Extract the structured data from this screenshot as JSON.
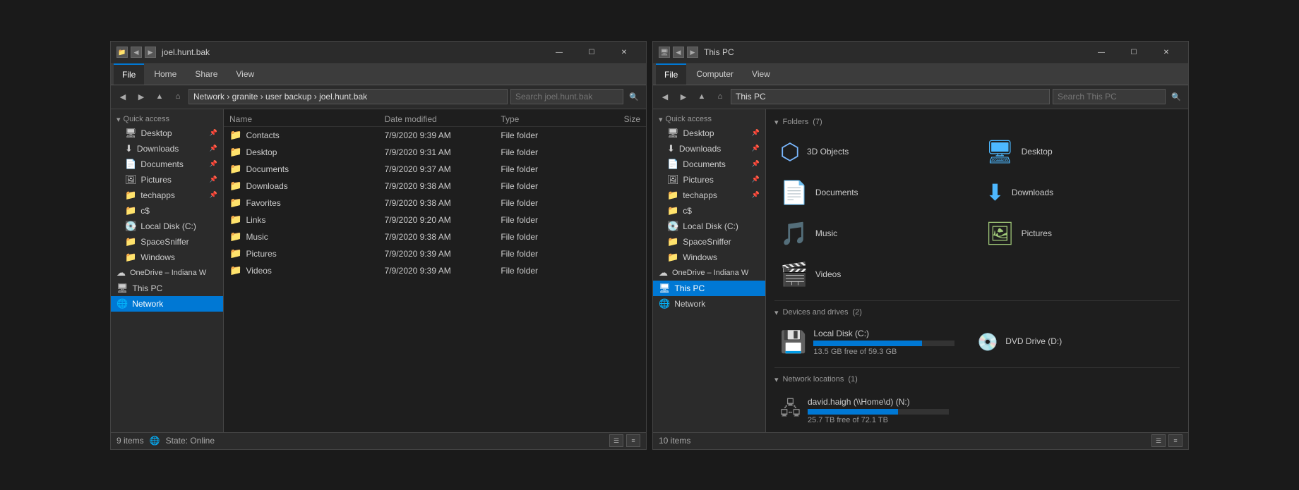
{
  "left_window": {
    "title": "joel.hunt.bak",
    "title_bar": {
      "icons": [
        "folder-icon",
        "back-icon",
        "forward-icon"
      ],
      "minimize": "—",
      "maximize": "☐",
      "close": "✕"
    },
    "ribbon_tabs": [
      "File",
      "Home",
      "Share",
      "View"
    ],
    "active_tab": "Home",
    "address_path": "Network > granite > user backup > joel.hunt.bak",
    "search_placeholder": "Search joel.hunt.bak",
    "nav": {
      "back_disabled": false,
      "forward_disabled": false
    },
    "columns": {
      "name": "Name",
      "date_modified": "Date modified",
      "type": "Type",
      "size": "Size"
    },
    "files": [
      {
        "name": "Contacts",
        "date": "7/9/2020 9:39 AM",
        "type": "File folder",
        "size": ""
      },
      {
        "name": "Desktop",
        "date": "7/9/2020 9:31 AM",
        "type": "File folder",
        "size": ""
      },
      {
        "name": "Documents",
        "date": "7/9/2020 9:37 AM",
        "type": "File folder",
        "size": ""
      },
      {
        "name": "Downloads",
        "date": "7/9/2020 9:38 AM",
        "type": "File folder",
        "size": ""
      },
      {
        "name": "Favorites",
        "date": "7/9/2020 9:38 AM",
        "type": "File folder",
        "size": ""
      },
      {
        "name": "Links",
        "date": "7/9/2020 9:20 AM",
        "type": "File folder",
        "size": ""
      },
      {
        "name": "Music",
        "date": "7/9/2020 9:38 AM",
        "type": "File folder",
        "size": ""
      },
      {
        "name": "Pictures",
        "date": "7/9/2020 9:39 AM",
        "type": "File folder",
        "size": ""
      },
      {
        "name": "Videos",
        "date": "7/9/2020 9:39 AM",
        "type": "File folder",
        "size": ""
      }
    ],
    "sidebar": {
      "quick_access_label": "Quick access",
      "items_quick": [
        {
          "label": "Desktop",
          "pinned": true
        },
        {
          "label": "Downloads",
          "pinned": true
        },
        {
          "label": "Documents",
          "pinned": true
        },
        {
          "label": "Pictures",
          "pinned": true
        },
        {
          "label": "techapps",
          "pinned": true
        }
      ],
      "items_other": [
        {
          "label": "c$"
        },
        {
          "label": "Local Disk (C:)"
        },
        {
          "label": "SpaceSniffer"
        },
        {
          "label": "Windows"
        }
      ],
      "onedrive_label": "OneDrive – Indiana W",
      "thispc_label": "This PC",
      "network_label": "Network"
    },
    "status": {
      "count": "9 items",
      "state": "State: Online",
      "state_icon": "🌐"
    }
  },
  "right_window": {
    "title": "This PC",
    "ribbon_tabs": [
      "File",
      "Computer",
      "View"
    ],
    "active_tab": "Computer",
    "address_path": "This PC",
    "search_placeholder": "Search This PC",
    "folders_section": {
      "label": "Folders",
      "count": 7,
      "items": [
        {
          "name": "3D Objects",
          "icon": "3d"
        },
        {
          "name": "Desktop",
          "icon": "desktop"
        },
        {
          "name": "Documents",
          "icon": "documents"
        },
        {
          "name": "Downloads",
          "icon": "downloads"
        },
        {
          "name": "Music",
          "icon": "music"
        },
        {
          "name": "Pictures",
          "icon": "pictures"
        },
        {
          "name": "Videos",
          "icon": "videos"
        }
      ]
    },
    "devices_section": {
      "label": "Devices and drives",
      "count": 2,
      "drives": [
        {
          "name": "Local Disk (C:)",
          "icon": "hdd",
          "free": "13.5 GB free of 59.3 GB",
          "fill_pct": 77
        },
        {
          "name": "DVD Drive (D:)",
          "icon": "dvd",
          "free": "",
          "fill_pct": 0
        }
      ]
    },
    "network_section": {
      "label": "Network locations",
      "count": 1,
      "locations": [
        {
          "name": "david.haigh (\\\\Home\\d) (N:)",
          "icon": "network-drive",
          "free": "25.7 TB free of 72.1 TB",
          "fill_pct": 64
        }
      ]
    },
    "sidebar": {
      "quick_access_label": "Quick access",
      "items_quick": [
        {
          "label": "Desktop",
          "pinned": true
        },
        {
          "label": "Downloads",
          "pinned": true
        },
        {
          "label": "Documents",
          "pinned": true
        },
        {
          "label": "Pictures",
          "pinned": true
        },
        {
          "label": "techapps",
          "pinned": true
        }
      ],
      "items_other": [
        {
          "label": "c$"
        },
        {
          "label": "Local Disk (C:)"
        },
        {
          "label": "SpaceSniffer"
        },
        {
          "label": "Windows"
        }
      ],
      "onedrive_label": "OneDrive – Indiana W",
      "thispc_label": "This PC",
      "network_label": "Network"
    },
    "status": {
      "count": "10 items"
    }
  }
}
